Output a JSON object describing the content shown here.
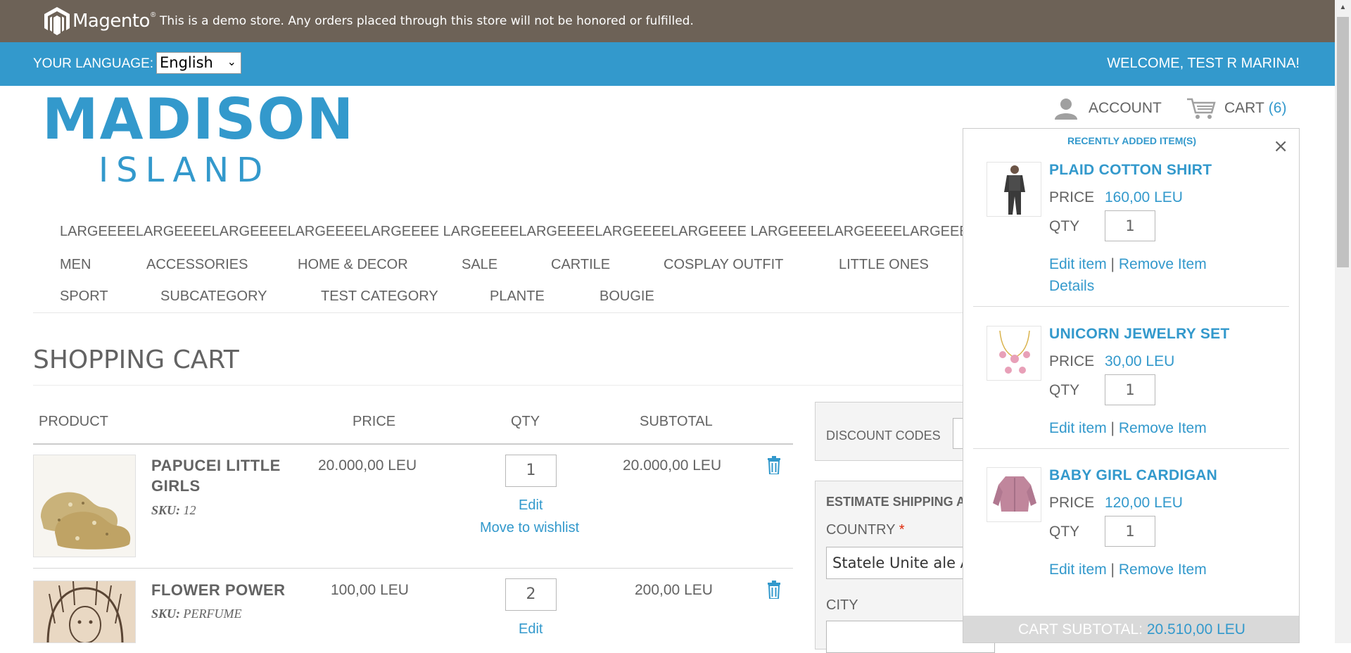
{
  "demo_notice": {
    "brand": "Magento",
    "text": "This is a demo store. Any orders placed through this store will not be honored or fulfilled."
  },
  "language_bar": {
    "label": "YOUR LANGUAGE:",
    "selected": "English",
    "welcome": "WELCOME, TEST R MARINA!"
  },
  "logo": {
    "line1": "MADISON",
    "line2": "ISLAND"
  },
  "header_links": {
    "account": "ACCOUNT",
    "cart": "CART",
    "cart_count": "(6)"
  },
  "nav": {
    "long_item": "LARGEEEELARGEEEELARGEEEELARGEEEELARGEEEE LARGEEEELARGEEEELARGEEEELARGEEEE LARGEEEELARGEEEELARGEEEE",
    "row1": [
      "MEN",
      "ACCESSORIES",
      "HOME & DECOR",
      "SALE",
      "CARTILE",
      "COSPLAY OUTFIT",
      "LITTLE ONES"
    ],
    "row2": [
      "SPORT",
      "SUBCATEGORY",
      "TEST CATEGORY",
      "PLANTE",
      "BOUGIE"
    ]
  },
  "cart": {
    "title": "SHOPPING CART",
    "headers": {
      "product": "PRODUCT",
      "price": "PRICE",
      "qty": "QTY",
      "subtotal": "SUBTOTAL"
    },
    "items": [
      {
        "name_line1": "PAPUCEI LITTLE",
        "name_line2": "GIRLS",
        "sku_label": "SKU:",
        "sku": "12",
        "price": "20.000,00 LEU",
        "qty": "1",
        "subtotal": "20.000,00 LEU",
        "edit": "Edit",
        "wishlist": "Move to wishlist"
      },
      {
        "name_line1": "FLOWER POWER",
        "sku_label": "SKU:",
        "sku": "PERFUME",
        "price": "100,00 LEU",
        "qty": "2",
        "subtotal": "200,00 LEU",
        "edit": "Edit"
      }
    ]
  },
  "sidebar": {
    "discount_label": "DISCOUNT CODES",
    "shipping_title": "ESTIMATE SHIPPING AI",
    "country_label": "COUNTRY",
    "country_required": "*",
    "country_value": "Statele Unite ale A",
    "city_label": "CITY"
  },
  "minicart": {
    "header": "RECENTLY ADDED ITEM(S)",
    "close": "×",
    "price_label": "PRICE",
    "qty_label": "QTY",
    "edit_label": "Edit item",
    "separator": "|",
    "remove_label": "Remove Item",
    "details_label": "Details",
    "items": [
      {
        "name": "PLAID COTTON SHIRT",
        "price": "160,00 LEU",
        "qty": "1"
      },
      {
        "name": "UNICORN JEWELRY SET",
        "price": "30,00 LEU",
        "qty": "1"
      },
      {
        "name": "BABY GIRL CARDIGAN",
        "price": "120,00 LEU",
        "qty": "1"
      }
    ],
    "subtotal_label": "CART SUBTOTAL:",
    "subtotal_value": "20.510,00 LEU"
  },
  "colors": {
    "demo_bar": "#6d6257",
    "accent": "#3399cc",
    "text": "#636363"
  }
}
